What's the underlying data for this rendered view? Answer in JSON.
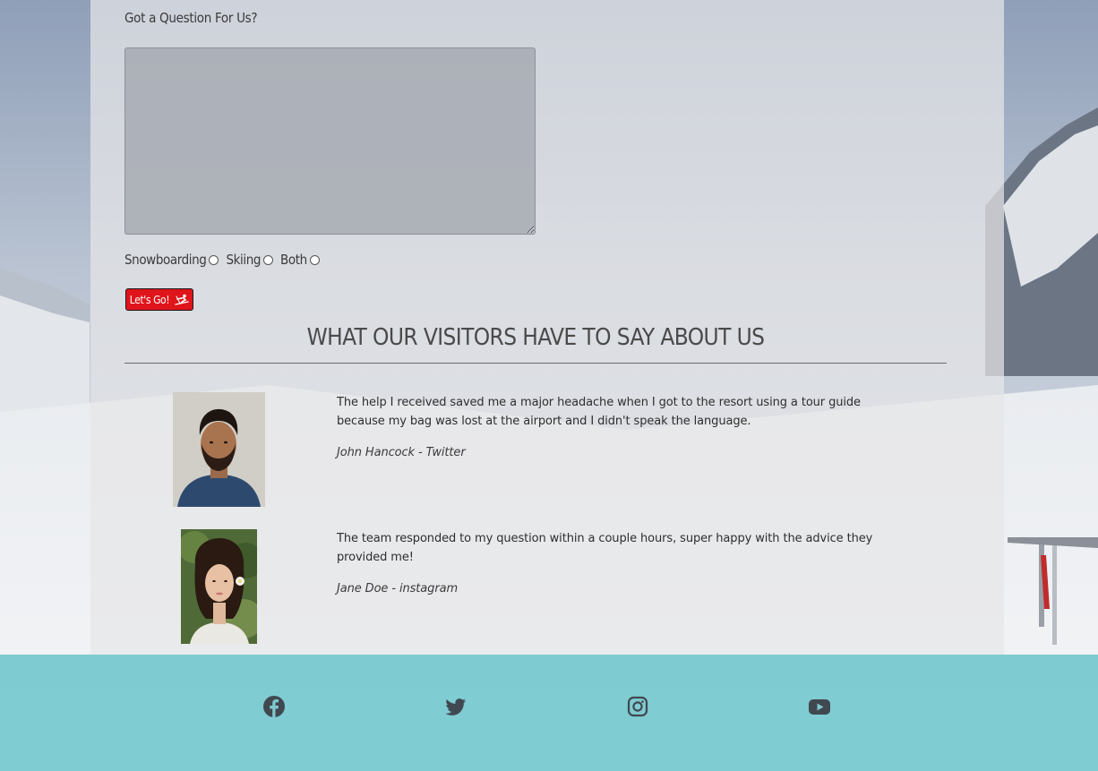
{
  "form": {
    "question_label": "Got a Question For Us?",
    "textarea_value": "",
    "radio_options": [
      {
        "label": "Snowboarding",
        "selected": false
      },
      {
        "label": "Skiing",
        "selected": false
      },
      {
        "label": "Both",
        "selected": false
      }
    ],
    "submit_label": "Let's Go!",
    "submit_icon": "skiing-icon",
    "submit_color": "#e0141b"
  },
  "testimonials": {
    "title": "WHAT OUR VISITORS HAVE TO SAY ABOUT US",
    "items": [
      {
        "text": "The help I received saved me a major headache when I got to the resort using a tour guide because my bag was lost at the airport and I didn't speak the language.",
        "author": "John Hancock - Twitter",
        "avatar": "man-portrait"
      },
      {
        "text": "The team responded to my question within a couple hours, super happy with the advice they provided me!",
        "author": "Jane Doe - instagram",
        "avatar": "woman-portrait"
      }
    ]
  },
  "footer": {
    "color": "#52bcc4",
    "social_icons": [
      "facebook-icon",
      "twitter-icon",
      "instagram-icon",
      "youtube-icon"
    ]
  }
}
